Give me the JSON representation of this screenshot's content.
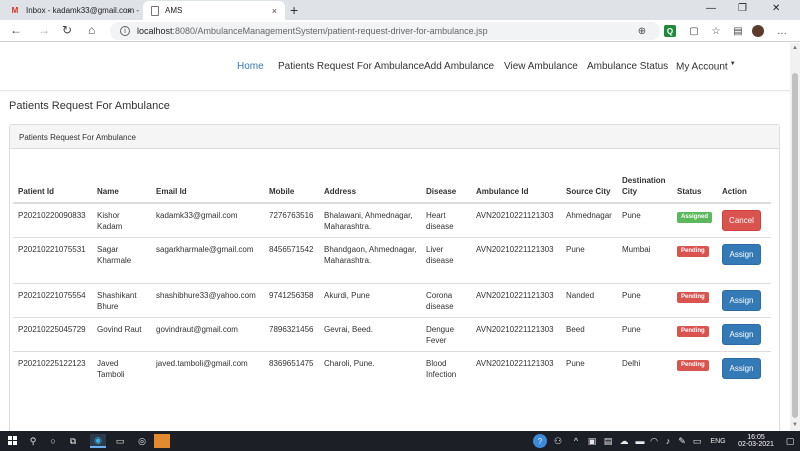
{
  "browser": {
    "tabs": [
      {
        "title": "Inbox - kadamk33@gmail.com -",
        "favicon": "gmail-icon"
      },
      {
        "title": "AMS",
        "favicon": "page-icon"
      }
    ],
    "url_host": "localhost",
    "url_path": ":8080/AmbulanceManagementSystem/patient-request-driver-for-ambulance.jsp",
    "new_tab": "+",
    "close_tab": "×"
  },
  "nav": {
    "items": [
      "Home",
      "Patients Request For Ambulance",
      "Add Ambulance",
      "View Ambulance",
      "Ambulance Status",
      "My Account"
    ],
    "active": "Home",
    "active_color": "#337ab7"
  },
  "page": {
    "title": "Patients Request For Ambulance",
    "panel_heading": "Patients Request For Ambulance"
  },
  "table": {
    "headers": [
      "Patient Id",
      "Name",
      "Email Id",
      "Mobile",
      "Address",
      "Disease",
      "Ambulance Id",
      "Source City",
      "Destination City",
      "Status",
      "Action"
    ],
    "rows": [
      {
        "id": "P20210220090833",
        "name": "Kishor Kadam",
        "email": "kadamk33@gmail.com",
        "mobile": "7276763516",
        "address": "Bhalawani, Ahmednagar, Maharashtra.",
        "disease": "Heart disease",
        "ambulance_id": "AVN20210221121303",
        "source": "Ahmednagar",
        "destination": "Pune",
        "status": "Assigned",
        "action": "Cancel"
      },
      {
        "id": "P20210221075531",
        "name": "Sagar Kharmale",
        "email": "sagarkharmale@gmail.com",
        "mobile": "8456571542",
        "address": "Bhandgaon, Ahmednagar, Maharashtra.",
        "disease": "Liver disease",
        "ambulance_id": "AVN20210221121303",
        "source": "Pune",
        "destination": "Mumbai",
        "status": "Pending",
        "action": "Assign"
      },
      {
        "id": "P20210221075554",
        "name": "Shashikant Bhure",
        "email": "shashibhure33@yahoo.com",
        "mobile": "9741256358",
        "address": "Akurdi, Pune",
        "disease": "Corona disease",
        "ambulance_id": "AVN20210221121303",
        "source": "Nanded",
        "destination": "Pune",
        "status": "Pending",
        "action": "Assign"
      },
      {
        "id": "P20210225045729",
        "name": "Govind Raut",
        "email": "govindraut@gmail.com",
        "mobile": "7896321456",
        "address": "Gevrai, Beed.",
        "disease": "Dengue Fever",
        "ambulance_id": "AVN20210221121303",
        "source": "Beed",
        "destination": "Pune",
        "status": "Pending",
        "action": "Assign"
      },
      {
        "id": "P20210225122123",
        "name": "Javed Tamboli",
        "email": "javed.tamboli@gmail.com",
        "mobile": "8369651475",
        "address": "Charoli, Pune.",
        "disease": "Blood Infection",
        "ambulance_id": "AVN20210221121303",
        "source": "Pune",
        "destination": "Delhi",
        "status": "Pending",
        "action": "Assign"
      }
    ]
  },
  "taskbar": {
    "lang": "ENG",
    "time": "16:05",
    "date": "02-03-2021"
  },
  "colors": {
    "assigned": "#5cb85c",
    "pending": "#d9534f",
    "assign_btn": "#337ab7",
    "cancel_btn": "#d9534f"
  }
}
